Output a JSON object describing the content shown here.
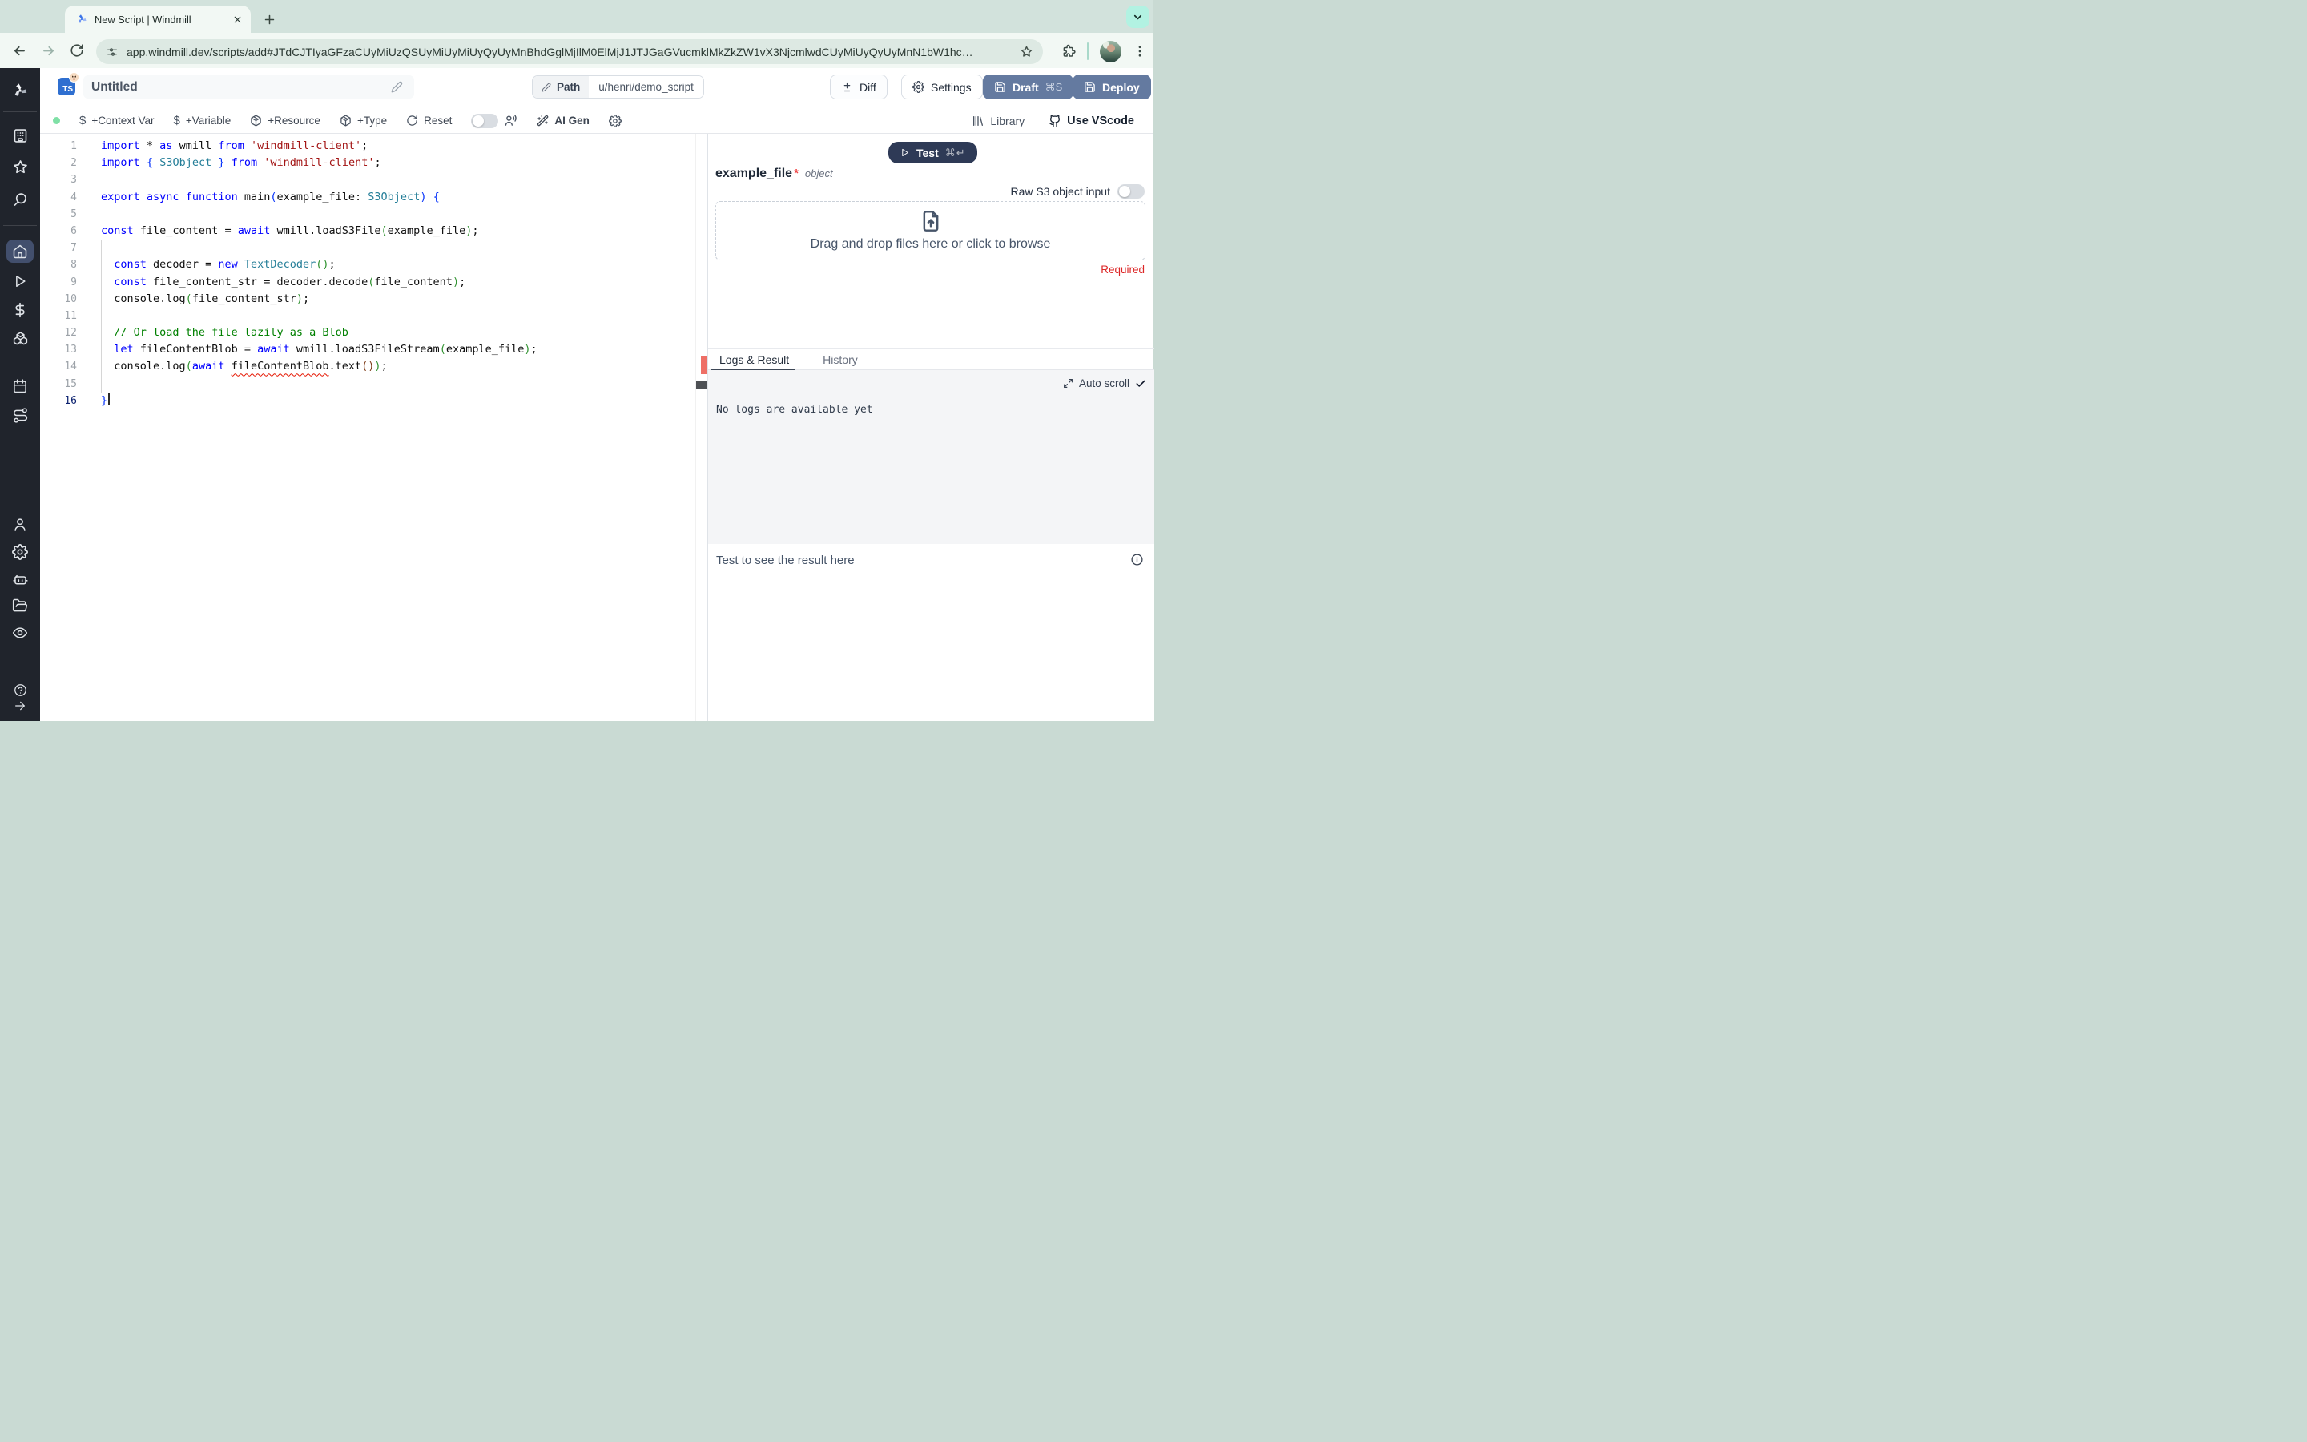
{
  "browser": {
    "tab_title": "New Script | Windmill",
    "url": "app.windmill.dev/scripts/add#JTdCJTIyaGFzaCUyMiUzQSUyMiUyMiUyQyUyMnBhdGglMjIlM0ElMjJ1JTJGaGVucmklMkZkZW1vX3NjcmlwdCUyMiUyQyUyMnN1bW1hc…"
  },
  "header": {
    "language_badge": "TS",
    "script_title": "Untitled",
    "path_label": "Path",
    "path_value": "u/henri/demo_script",
    "diff_label": "Diff",
    "settings_label": "Settings",
    "draft_label": "Draft",
    "draft_shortcut": "⌘S",
    "deploy_label": "Deploy"
  },
  "toolbar": {
    "context_var": "+Context Var",
    "variable": "+Variable",
    "resource": "+Resource",
    "type": "+Type",
    "reset": "Reset",
    "ai_gen": "AI Gen",
    "library": "Library",
    "use_vscode": "Use VScode"
  },
  "editor": {
    "active_line": 16,
    "lines": [
      [
        [
          "k",
          "import "
        ],
        [
          "d",
          "* "
        ],
        [
          "k",
          "as "
        ],
        [
          "d",
          "wmill "
        ],
        [
          "k",
          "from "
        ],
        [
          "s",
          "'windmill-client'"
        ],
        [
          "d",
          ";"
        ]
      ],
      [
        [
          "k",
          "import "
        ],
        [
          "b1",
          "{"
        ],
        [
          "d",
          " "
        ],
        [
          "t",
          "S3Object"
        ],
        [
          "d",
          " "
        ],
        [
          "b1",
          "}"
        ],
        [
          "d",
          " "
        ],
        [
          "k",
          "from "
        ],
        [
          "s",
          "'windmill-client'"
        ],
        [
          "d",
          ";"
        ]
      ],
      [],
      [
        [
          "k",
          "export "
        ],
        [
          "k",
          "async "
        ],
        [
          "k",
          "function "
        ],
        [
          "d",
          "main"
        ],
        [
          "b1",
          "("
        ],
        [
          "d",
          "example_file: "
        ],
        [
          "t",
          "S3Object"
        ],
        [
          "b1",
          ")"
        ],
        [
          "d",
          " "
        ],
        [
          "b1",
          "{"
        ]
      ],
      [],
      [
        [
          "k",
          "const "
        ],
        [
          "d",
          "file_content = "
        ],
        [
          "k",
          "await "
        ],
        [
          "d",
          "wmill.loadS3File"
        ],
        [
          "b2",
          "("
        ],
        [
          "d",
          "example_file"
        ],
        [
          "b2",
          ")"
        ],
        [
          "d",
          ";"
        ]
      ],
      [],
      [
        [
          "d",
          "  "
        ],
        [
          "k",
          "const "
        ],
        [
          "d",
          "decoder = "
        ],
        [
          "k",
          "new "
        ],
        [
          "t",
          "TextDecoder"
        ],
        [
          "b2",
          "()"
        ],
        [
          "d",
          ";"
        ]
      ],
      [
        [
          "d",
          "  "
        ],
        [
          "k",
          "const "
        ],
        [
          "d",
          "file_content_str = decoder.decode"
        ],
        [
          "b2",
          "("
        ],
        [
          "d",
          "file_content"
        ],
        [
          "b2",
          ")"
        ],
        [
          "d",
          ";"
        ]
      ],
      [
        [
          "d",
          "  console.log"
        ],
        [
          "b2",
          "("
        ],
        [
          "d",
          "file_content_str"
        ],
        [
          "b2",
          ")"
        ],
        [
          "d",
          ";"
        ]
      ],
      [],
      [
        [
          "d",
          "  "
        ],
        [
          "c",
          "// Or load the file lazily as a Blob"
        ]
      ],
      [
        [
          "d",
          "  "
        ],
        [
          "k",
          "let "
        ],
        [
          "d",
          "fileContentBlob = "
        ],
        [
          "k",
          "await "
        ],
        [
          "d",
          "wmill.loadS3FileStream"
        ],
        [
          "b2",
          "("
        ],
        [
          "d",
          "example_file"
        ],
        [
          "b2",
          ")"
        ],
        [
          "d",
          ";"
        ]
      ],
      [
        [
          "d",
          "  console.log"
        ],
        [
          "b2",
          "("
        ],
        [
          "k",
          "await "
        ],
        [
          "e",
          "fileContentBlob"
        ],
        [
          "d",
          ".text"
        ],
        [
          "b3",
          "()"
        ],
        [
          "b2",
          ")"
        ],
        [
          "d",
          ";"
        ]
      ],
      [],
      [
        [
          "b1",
          "}"
        ]
      ]
    ]
  },
  "right_panel": {
    "test_label": "Test",
    "test_shortcut": "⌘↵",
    "arg_name": "example_file",
    "arg_required_mark": "*",
    "arg_type": "object",
    "raw_s3_label": "Raw S3 object input",
    "dropzone_text": "Drag and drop files here or click to browse",
    "required_label": "Required",
    "tabs": {
      "logs": "Logs & Result",
      "history": "History"
    },
    "auto_scroll_label": "Auto scroll",
    "no_logs_text": "No logs are available yet",
    "result_placeholder": "Test to see the result here"
  },
  "sidebar_icons": [
    "windmill-logo",
    "apps",
    "favorites",
    "search",
    "home",
    "runs",
    "variables",
    "resources",
    "schedules",
    "flows",
    "user",
    "settings",
    "workers",
    "folders",
    "audit",
    "help",
    "collapse"
  ],
  "icons": {
    "browser": [
      "back-arrow",
      "forward-arrow",
      "reload",
      "site-settings",
      "bookmark-star",
      "extensions-puzzle",
      "profile-avatar",
      "menu-dots",
      "new-tab-plus",
      "close-x",
      "chevron-down"
    ],
    "app": [
      "pencil",
      "diff-plus-minus",
      "gear",
      "save-floppy",
      "dollar",
      "package",
      "reset-rotate",
      "multiplayer-users",
      "ai-wand",
      "library-books",
      "vscode-octocat",
      "play-triangle",
      "file-upload",
      "expand-arrows",
      "checkmark",
      "info-circle"
    ]
  },
  "colors": {
    "chrome_bg": "#d2e2dc",
    "chrome_toolbar": "#f2f8f4",
    "mint_button": "#b2f2e2",
    "sidebar_bg": "#20242c",
    "sidebar_active": "#424f6d",
    "primary_button": "#647aa0",
    "test_button": "#2e3a56",
    "ai_gen": "#7d3aed",
    "error_red": "#dc2626",
    "squiggle_red": "#e51400",
    "green_status_dot": "#7fe0a6"
  }
}
